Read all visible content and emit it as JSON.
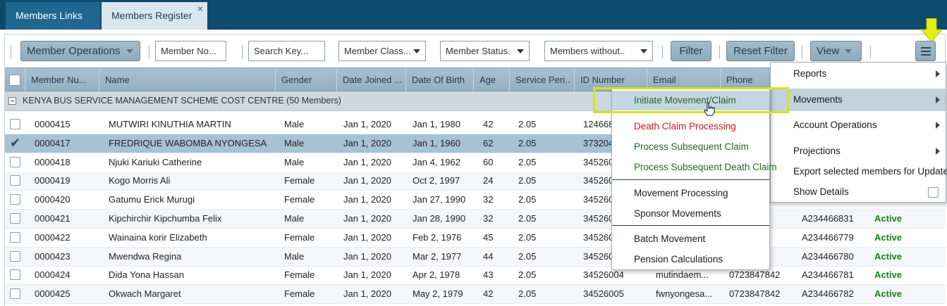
{
  "tabs": [
    {
      "label": "Members Links"
    },
    {
      "label": "Members Register",
      "close": "×"
    }
  ],
  "toolbar": {
    "member_operations": "Member Operations",
    "member_no_placeholder": "Member No...",
    "search_key_placeholder": "Search Key...",
    "member_class": "Member Class...",
    "member_status": "Member Status.",
    "members_without": "Members without..",
    "filter": "Filter",
    "reset_filter": "Reset Filter",
    "view": "View"
  },
  "columns": [
    "Member Nu...",
    "Name",
    "Gender",
    "Date Joined ...",
    "Date Of Birth",
    "Age",
    "Service Peri..",
    "ID Number",
    "Email",
    "Phone"
  ],
  "group_label": "KENYA BUS SERVICE MANAGEMENT SCHEME COST CENTRE (50 Members)",
  "rows": [
    {
      "member_no": "0000415",
      "name": "MUTWIRI KINUTHIA MARTIN",
      "gender": "Male",
      "date_joined": "Jan 1, 2020",
      "dob": "Jan 1, 1980",
      "age": "42",
      "service": "2.05",
      "id_number": "124668",
      "email": "",
      "phone": "",
      "extra": "",
      "status": "",
      "checked": false
    },
    {
      "member_no": "0000417",
      "name": "FREDRIQUE WABOMBA NYONGESA",
      "gender": "Male",
      "date_joined": "Jan 1, 2020",
      "dob": "Jan 1, 1960",
      "age": "62",
      "service": "2.05",
      "id_number": "373204",
      "email": "",
      "phone": "",
      "extra": "",
      "status": "",
      "checked": true
    },
    {
      "member_no": "0000418",
      "name": "Njuki Kariuki Catherine",
      "gender": "Male",
      "date_joined": "Jan 1, 2020",
      "dob": "Jan 4, 1962",
      "age": "60",
      "service": "2.05",
      "id_number": "345260",
      "email": "",
      "phone": "",
      "extra": "",
      "status": "",
      "checked": false
    },
    {
      "member_no": "0000419",
      "name": "Kogo Morris Ali",
      "gender": "Female",
      "date_joined": "Jan 1, 2020",
      "dob": "Oct 2, 1997",
      "age": "24",
      "service": "2.05",
      "id_number": "345260",
      "email": "",
      "phone": "",
      "extra": "",
      "status": "",
      "checked": false
    },
    {
      "member_no": "0000420",
      "name": "Gatumu Erick Murugi",
      "gender": "Female",
      "date_joined": "Jan 1, 2020",
      "dob": "Jan 27, 1990",
      "age": "32",
      "service": "2.05",
      "id_number": "345260",
      "email": "",
      "phone": "",
      "extra": "",
      "status": "",
      "checked": false
    },
    {
      "member_no": "0000421",
      "name": "Kipchirchir Kipchumba Felix",
      "gender": "Male",
      "date_joined": "Jan 1, 2020",
      "dob": "Jan 28, 1990",
      "age": "32",
      "service": "2.05",
      "id_number": "345260",
      "email": "",
      "phone": "2",
      "extra": "A234466831",
      "status": "Active",
      "checked": false
    },
    {
      "member_no": "0000422",
      "name": "Wainaina korir Elizabeth",
      "gender": "Female",
      "date_joined": "Jan 1, 2020",
      "dob": "Feb 2, 1976",
      "age": "45",
      "service": "2.05",
      "id_number": "345260",
      "email": "",
      "phone": "2",
      "extra": "A234466779",
      "status": "Active",
      "checked": false
    },
    {
      "member_no": "0000423",
      "name": "Mwendwa Regina",
      "gender": "Male",
      "date_joined": "Jan 1, 2020",
      "dob": "Mar 2, 1977",
      "age": "44",
      "service": "2.05",
      "id_number": "345260",
      "email": "",
      "phone": "2",
      "extra": "A234466780",
      "status": "Active",
      "checked": false
    },
    {
      "member_no": "0000424",
      "name": "Dida Yona Hassan",
      "gender": "Female",
      "date_joined": "Jan 1, 2020",
      "dob": "Apr 2, 1978",
      "age": "43",
      "service": "2.05",
      "id_number": "34526004",
      "email": "mutindaem...",
      "phone": "0723847842",
      "extra": "A234466781",
      "status": "Active",
      "checked": false
    },
    {
      "member_no": "0000425",
      "name": "Okwach Margaret",
      "gender": "Female",
      "date_joined": "Jan 1, 2020",
      "dob": "May 2, 1979",
      "age": "42",
      "service": "2.05",
      "id_number": "34526005",
      "email": "fwnyongesa...",
      "phone": "0723847842",
      "extra": "A234466782",
      "status": "Active",
      "checked": false
    }
  ],
  "menu": {
    "items": [
      {
        "label": "Reports",
        "arrow": true
      },
      {
        "label": "Movements",
        "arrow": true,
        "active": true
      },
      {
        "label": "Account Operations",
        "arrow": true
      },
      {
        "label": "Projections",
        "arrow": true
      },
      {
        "label": "Export selected members for Update",
        "arrow": false
      },
      {
        "label": "Show Details",
        "arrow": false,
        "checkbox": true
      }
    ]
  },
  "submenu": {
    "items": [
      {
        "label": "Initiate Movement/Claim",
        "style": "hl"
      },
      {
        "label": "Death Claim Processing",
        "style": "red"
      },
      {
        "label": "Process Subsequent Claim",
        "style": "green"
      },
      {
        "label": "Process Subsequent Death Claim",
        "style": "green"
      },
      {
        "label": "Movement Processing",
        "style": ""
      },
      {
        "label": "Sponsor Movements",
        "style": ""
      },
      {
        "label": "Batch Movement",
        "style": ""
      },
      {
        "label": "Pension Calculations",
        "style": ""
      }
    ]
  },
  "colors": {
    "header_bar": "#0c4a6e",
    "highlight": "#d6e21a",
    "active_status": "#1e7d1e",
    "red_item": "#d11a1a"
  }
}
